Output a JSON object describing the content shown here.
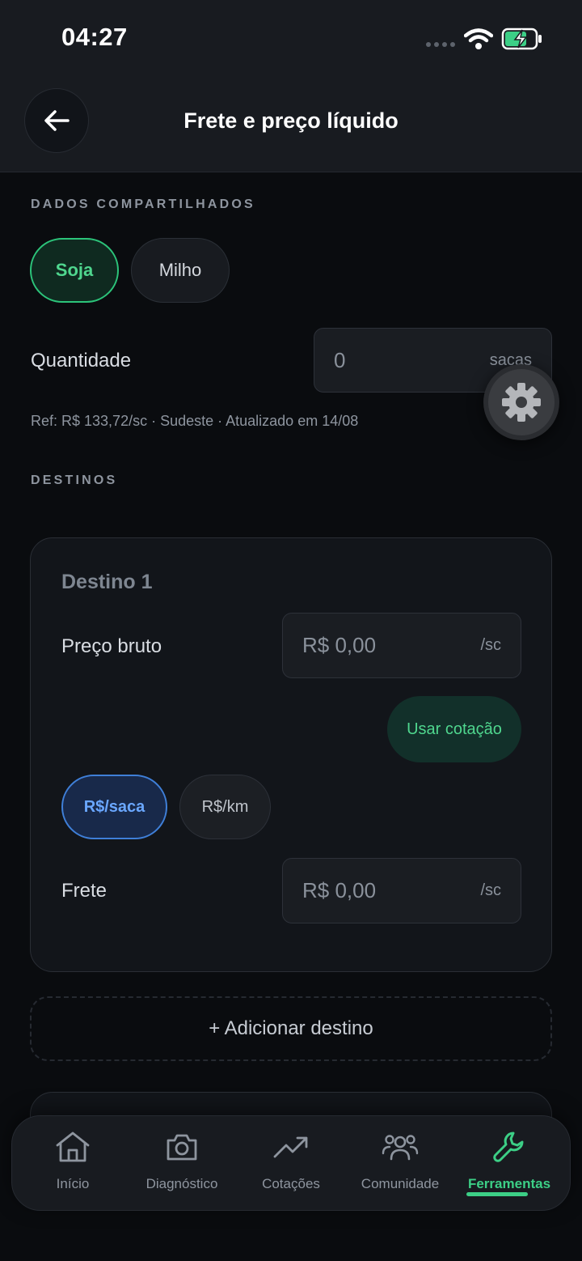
{
  "status_bar": {
    "time": "04:27"
  },
  "header": {
    "title": "Frete e preço líquido"
  },
  "shared": {
    "section_label": "DADOS COMPARTILHADOS",
    "crops": [
      {
        "label": "Soja",
        "selected": true
      },
      {
        "label": "Milho",
        "selected": false
      }
    ],
    "quantity_label": "Quantidade",
    "quantity_value": "0",
    "quantity_unit": "sacas",
    "reference": "Ref: R$ 133,72/sc · Sudeste · Atualizado em 14/08"
  },
  "destinations": {
    "section_label": "DESTINOS",
    "items": [
      {
        "title": "Destino 1",
        "gross_price_label": "Preço bruto",
        "gross_price_value": "R$ 0,00",
        "gross_price_unit": "/sc",
        "use_quote_label": "Usar cotação",
        "freight_units": [
          {
            "label": "R$/saca",
            "selected": true
          },
          {
            "label": "R$/km",
            "selected": false
          }
        ],
        "freight_label": "Frete",
        "freight_value": "R$ 0,00",
        "freight_unit": "/sc"
      }
    ],
    "add_label": "+ Adicionar destino"
  },
  "nav": {
    "items": [
      {
        "label": "Início",
        "icon": "home-icon",
        "active": false
      },
      {
        "label": "Diagnóstico",
        "icon": "camera-icon",
        "active": false
      },
      {
        "label": "Cotações",
        "icon": "trending-up-icon",
        "active": false
      },
      {
        "label": "Comunidade",
        "icon": "users-icon",
        "active": false
      },
      {
        "label": "Ferramentas",
        "icon": "wrench-icon",
        "active": true
      }
    ]
  },
  "colors": {
    "accent_green": "#3ccf86",
    "accent_blue": "#3f7fd8",
    "background": "#0a0c0f"
  }
}
